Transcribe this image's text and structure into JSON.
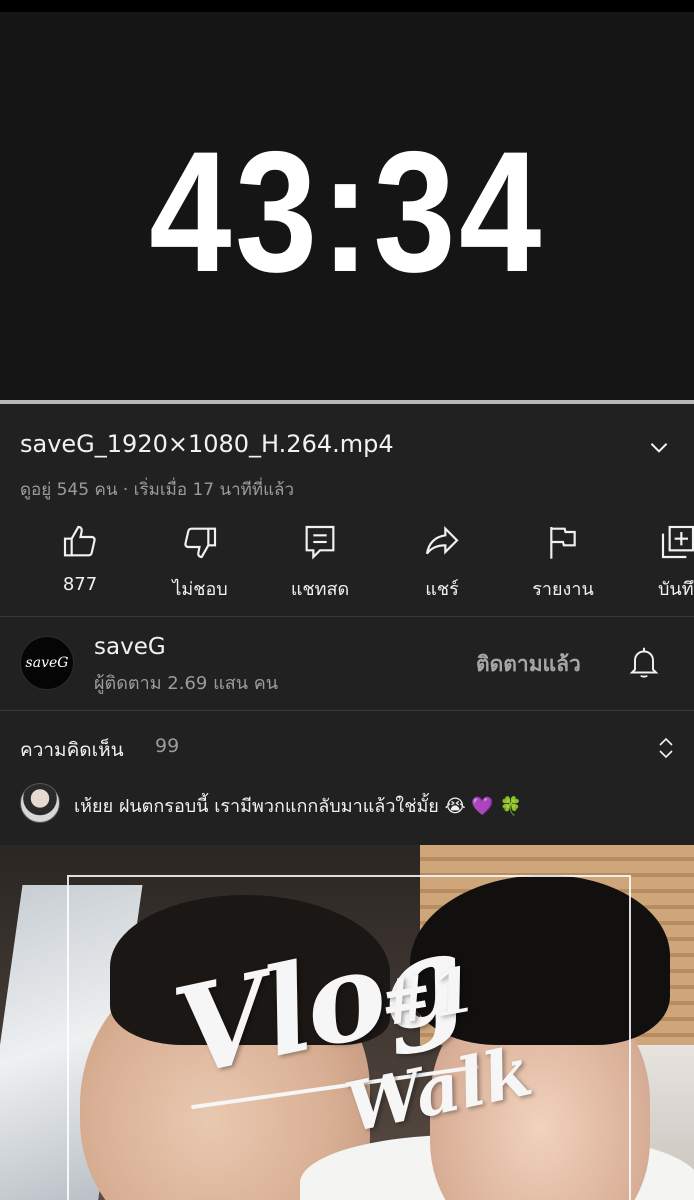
{
  "player": {
    "countdown": "43:34"
  },
  "video": {
    "title": "saveG_1920×1080_H.264.mp4",
    "meta": "ดูอยู่ 545 คน · เริ่มเมื่อ 17 นาทีที่แล้ว"
  },
  "actions": [
    {
      "label": "877",
      "icon": "thumbs-up-icon"
    },
    {
      "label": "ไม่ชอบ",
      "icon": "thumbs-down-icon"
    },
    {
      "label": "แชทสด",
      "icon": "chat-icon"
    },
    {
      "label": "แชร์",
      "icon": "share-icon"
    },
    {
      "label": "รายงาน",
      "icon": "flag-icon"
    },
    {
      "label": "บันทึ",
      "icon": "save-playlist-icon"
    }
  ],
  "channel": {
    "avatar_text": "saveG",
    "name": "saveG",
    "subscribers": "ผู้ติดตาม 2.69 แสน คน",
    "subscribed_label": "ติดตามแล้ว"
  },
  "comments": {
    "heading": "ความคิดเห็น",
    "count": "99",
    "top_comment": "เห้ยย ฝนตกรอบนี้ เรามีพวกแกกลับมาแล้วใช่มั้ย 😭 💜 🍀"
  },
  "thumbnail": {
    "title_vlog": "Vlog",
    "title_num": "#1",
    "title_walk": "Walk"
  },
  "colors": {
    "background": "#212121",
    "player": "#151515",
    "muted_text": "#9b9b9b"
  }
}
